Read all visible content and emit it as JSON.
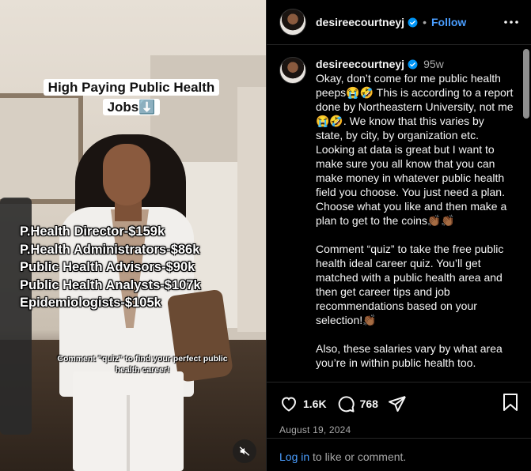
{
  "media": {
    "title": "High Paying Public Health Jobs⬇️",
    "salaries": [
      "P.Health Director-$159k",
      "P.Health Administrators-$86k",
      "Public Health Advisors-$90k",
      "Public Health Analysts-$107k",
      "Epidemiologists-$105k"
    ],
    "caption": "Comment “quiz” to find your perfect public health career!"
  },
  "header": {
    "username": "desireecourtneyj",
    "separator": "•",
    "follow_label": "Follow"
  },
  "post": {
    "username": "desireecourtneyj",
    "time_ago": "95w",
    "paragraphs": [
      "Okay, don’t come for me public health peeps😭🤣 This is according to a report done by Northeastern University, not me😭🤣. We know that this varies by state, by city, by organization etc. Looking at data is great but I want to make sure you all know that you can make money in whatever public health field you choose. You just need a plan. Choose what you like and then make a plan to get to the coins👏🏾👏🏾",
      "Comment “quiz” to take the free public health ideal career quiz. You’ll get matched with a public health area and then get career tips and job recommendations based on your selection!👏🏾",
      "Also, these salaries vary by what area you’re in within public health too."
    ]
  },
  "actions": {
    "likes": "1.6K",
    "comments": "768",
    "date": "August 19, 2024"
  },
  "login": {
    "link_label": "Log in",
    "suffix": " to like or comment."
  },
  "colors": {
    "accent": "#4a9eff",
    "background": "#000000",
    "secondary_text": "#a8a8a8"
  },
  "icons": [
    "verified-badge-icon",
    "more-options-icon",
    "heart-icon",
    "comment-icon",
    "share-icon",
    "bookmark-icon",
    "muted-speaker-icon"
  ]
}
